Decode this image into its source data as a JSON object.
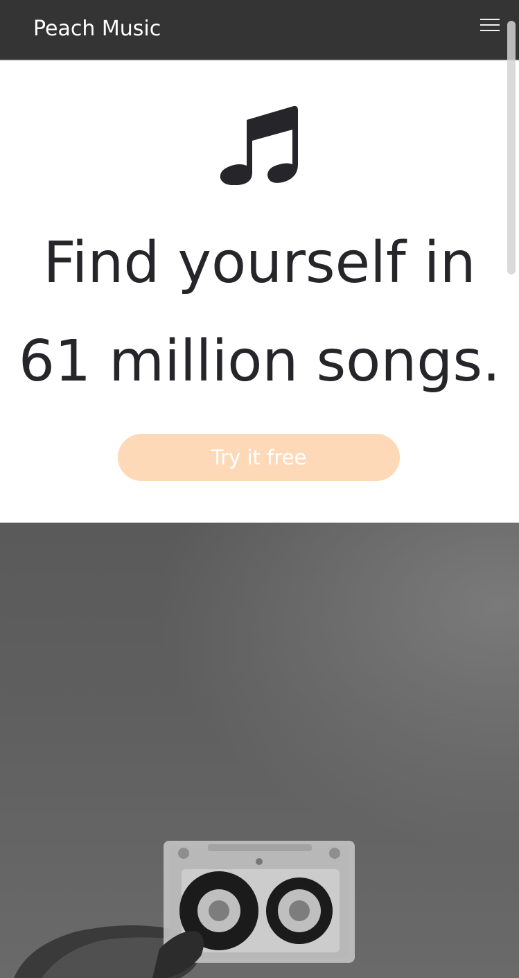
{
  "navbar": {
    "brand": "Peach Music",
    "menu_icon": "hamburger-menu-icon"
  },
  "hero": {
    "icon": "music-note-icon",
    "headline_line1": "Find yourself in",
    "headline_line2": "61 million songs.",
    "cta_label": "Try it free"
  },
  "photo": {
    "subject": "cassette-tape-in-hand-image"
  },
  "colors": {
    "navbar_bg": "#343434",
    "text_dark": "#25252a",
    "cta_bg": "#fdd9b8",
    "cta_text": "#ffffff"
  }
}
